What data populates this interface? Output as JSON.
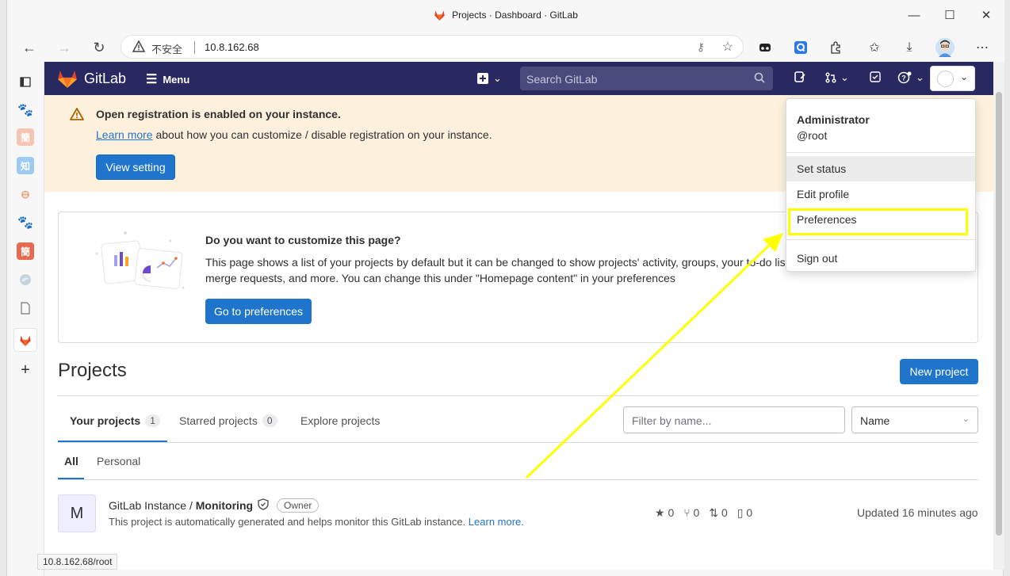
{
  "window": {
    "title": "Projects · Dashboard · GitLab",
    "minimize": "—",
    "maximize": "☐",
    "close": "✕"
  },
  "browser": {
    "insecure_label": "不安全",
    "url": "10.8.162.68",
    "status_url": "10.8.162.68/root",
    "sidebar_icons": [
      "tabs-icon",
      "baidu-paw-icon",
      "jian-icon",
      "zhi-icon",
      "link-icon",
      "baidu-icon",
      "jian-red-icon",
      "edge-icon",
      "document-icon",
      "gitlab-icon",
      "add-icon"
    ],
    "sidebar_labels": {
      "jian": "簡",
      "zhi": "知",
      "jian2": "簡"
    }
  },
  "gitlab": {
    "brand": "GitLab",
    "menu_label": "Menu",
    "search_placeholder": "Search GitLab"
  },
  "banner": {
    "title": "Open registration is enabled on your instance.",
    "learn_more": "Learn more",
    "text": " about how you can customize / disable registration on your instance.",
    "button": "View setting"
  },
  "customize": {
    "title": "Do you want to customize this page?",
    "text": "This page shows a list of your projects by default but it can be changed to show projects' activity, groups, your to-do list, merge requests, and more. You can change this under \"Homepage content\" in your preferences",
    "button": "Go to preferences"
  },
  "projects": {
    "title": "Projects",
    "new_button": "New project",
    "tabs": [
      {
        "label": "Your projects",
        "count": "1"
      },
      {
        "label": "Starred projects",
        "count": "0"
      },
      {
        "label": "Explore projects"
      }
    ],
    "filter_placeholder": "Filter by name...",
    "sort_value": "Name",
    "subtabs": [
      "All",
      "Personal"
    ],
    "rows": [
      {
        "avatar": "M",
        "namespace": "GitLab Instance / ",
        "name": "Monitoring",
        "role": "Owner",
        "description": "This project is automatically generated and helps monitor this GitLab instance. ",
        "learn_more": "Learn more.",
        "stars": "0",
        "forks": "0",
        "merge_requests": "0",
        "issues": "0",
        "updated": "Updated 16 minutes ago"
      }
    ]
  },
  "user_menu": {
    "name": "Administrator",
    "username": "@root",
    "items": [
      "Set status",
      "Edit profile",
      "Preferences",
      "Sign out"
    ]
  },
  "colors": {
    "gitlab_nav": "#292961",
    "primary": "#1f75cb",
    "banner_bg": "#fdf1dd",
    "highlight": "#ffff00"
  }
}
